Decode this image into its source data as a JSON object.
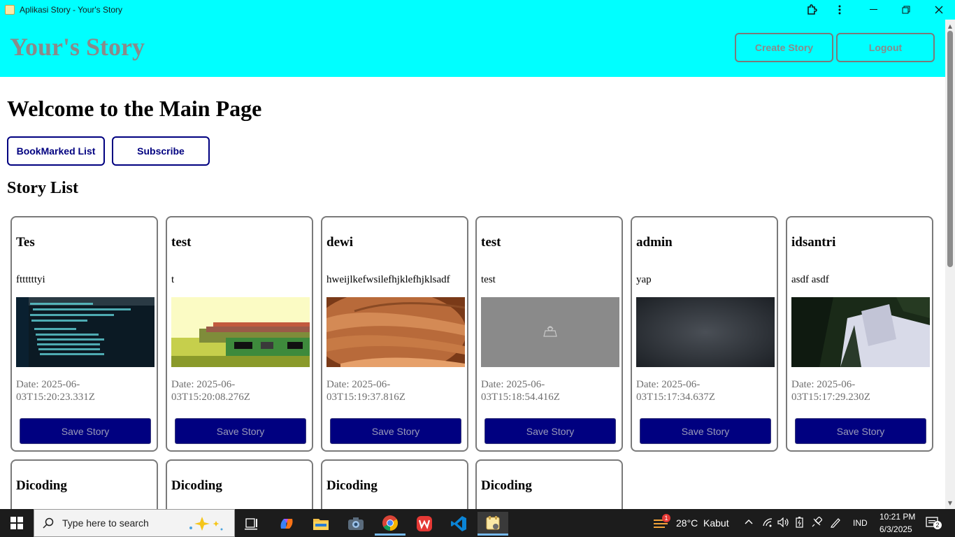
{
  "window": {
    "title": "Aplikasi Story - Your's Story"
  },
  "header": {
    "brand": "Your's Story",
    "create_label": "Create Story",
    "logout_label": "Logout"
  },
  "main": {
    "title": "Welcome to the Main Page",
    "bookmarked_label": "BookMarked List",
    "subscribe_label": "Subscribe",
    "list_title": "Story List"
  },
  "stories": [
    {
      "name": "Tes",
      "description": "fttttttyi",
      "date": "Date: 2025-06-03T15:20:23.331Z",
      "save_label": "Save Story"
    },
    {
      "name": "test",
      "description": "t",
      "date": "Date: 2025-06-03T15:20:08.276Z",
      "save_label": "Save Story"
    },
    {
      "name": "dewi",
      "description": "hweijlkefwsilefhjklefhjklsadf",
      "date": "Date: 2025-06-03T15:19:37.816Z",
      "save_label": "Save Story"
    },
    {
      "name": "test",
      "description": "test",
      "date": "Date: 2025-06-03T15:18:54.416Z",
      "save_label": "Save Story"
    },
    {
      "name": "admin",
      "description": "yap",
      "date": "Date: 2025-06-03T15:17:34.637Z",
      "save_label": "Save Story"
    },
    {
      "name": "idsantri",
      "description": "asdf asdf",
      "date": "Date: 2025-06-03T15:17:29.230Z",
      "save_label": "Save Story"
    }
  ],
  "stories_row2": [
    {
      "name": "Dicoding"
    },
    {
      "name": "Dicoding"
    },
    {
      "name": "Dicoding"
    },
    {
      "name": "Dicoding"
    }
  ],
  "taskbar": {
    "search_placeholder": "Type here to search",
    "weather_temp": "28°C",
    "weather_desc": "Kabut",
    "weather_badge": "1",
    "language": "IND",
    "time": "10:21 PM",
    "date": "6/3/2025",
    "notifications": "2"
  },
  "colors": {
    "header_bg": "#00ffff",
    "accent": "#000080"
  }
}
